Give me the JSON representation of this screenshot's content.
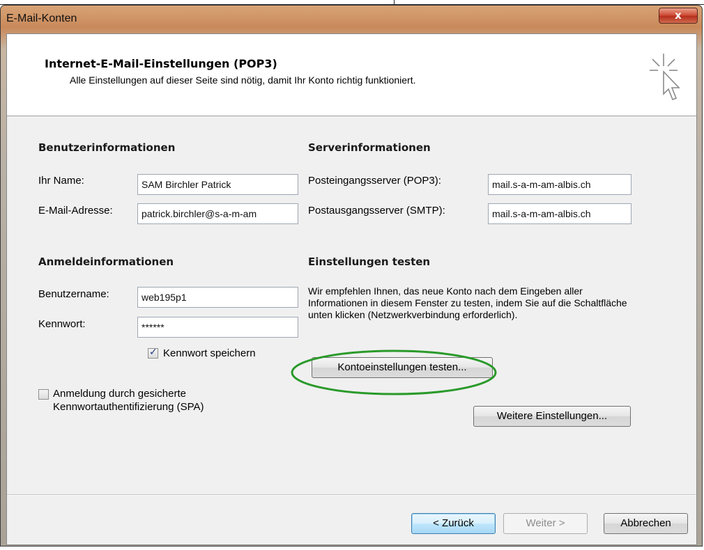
{
  "window": {
    "title": "E-Mail-Konten",
    "close_glyph": "x"
  },
  "header": {
    "title": "Internet-E-Mail-Einstellungen (POP3)",
    "subtitle": "Alle Einstellungen auf dieser Seite sind nötig, damit Ihr Konto richtig funktioniert.",
    "icon": "cursor-sparkle-icon"
  },
  "user_info": {
    "heading": "Benutzerinformationen",
    "name_label": "Ihr Name:",
    "name_value": "SAM Birchler Patrick",
    "email_label": "E-Mail-Adresse:",
    "email_value": "patrick.birchler@s-a-m-am"
  },
  "server_info": {
    "heading": "Serverinformationen",
    "incoming_label": "Posteingangsserver (POP3):",
    "incoming_value": "mail.s-a-m-am-albis.ch",
    "outgoing_label": "Postausgangsserver (SMTP):",
    "outgoing_value": "mail.s-a-m-am-albis.ch"
  },
  "login_info": {
    "heading": "Anmeldeinformationen",
    "username_label": "Benutzername:",
    "username_value": "web195p1",
    "password_label": "Kennwort:",
    "password_value": "******",
    "save_password_label": "Kennwort speichern",
    "save_password_checked": true,
    "spa_label_line1": "Anmeldung durch gesicherte",
    "spa_label_line2": "Kennwortauthentifizierung (SPA)",
    "spa_checked": false
  },
  "test_settings": {
    "heading": "Einstellungen testen",
    "description": "Wir empfehlen Ihnen, das neue Konto nach dem Eingeben aller Informationen in diesem Fenster zu testen, indem Sie auf die Schaltfläche unten klicken (Netzwerkverbindung erforderlich).",
    "test_button_label": "Kontoeinstellungen testen...",
    "highlight_color": "#2a9a2a"
  },
  "more_settings_button": "Weitere Einstellungen...",
  "footer": {
    "back_label": "< Zurück",
    "next_label": "Weiter >",
    "cancel_label": "Abbrechen"
  },
  "colors": {
    "title_bar": "#c9895a",
    "close_button": "#c8452e",
    "default_button": "#a7d9f5"
  }
}
